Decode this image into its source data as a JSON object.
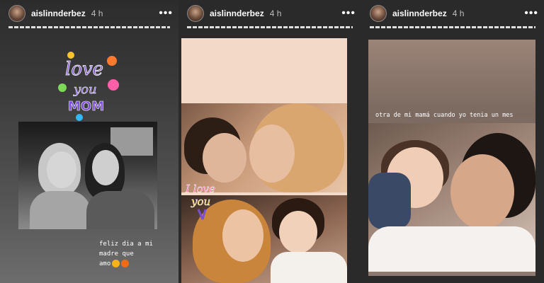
{
  "stories": [
    {
      "username": "aislinnderbez",
      "time": "4 h",
      "more_icon": "more-dots-icon",
      "sticker_lines": [
        "love",
        "you",
        "MOM"
      ],
      "caption_lines": [
        "feliz dia a mi",
        "madre que",
        "amo"
      ]
    },
    {
      "username": "aislinnderbez",
      "time": "4 h",
      "more_icon": "more-dots-icon",
      "sticker_lines": [
        "I love",
        "you"
      ]
    },
    {
      "username": "aislinnderbez",
      "time": "4 h",
      "more_icon": "more-dots-icon",
      "caption": "otra de mi mamá cuando yo tenia un mes"
    }
  ],
  "colors": {
    "sticker_purple": "#7a4fd6",
    "sticker_pink": "#ff5fa8",
    "sticker_yellow": "#f7c52b",
    "sticker_green": "#7ed957"
  }
}
